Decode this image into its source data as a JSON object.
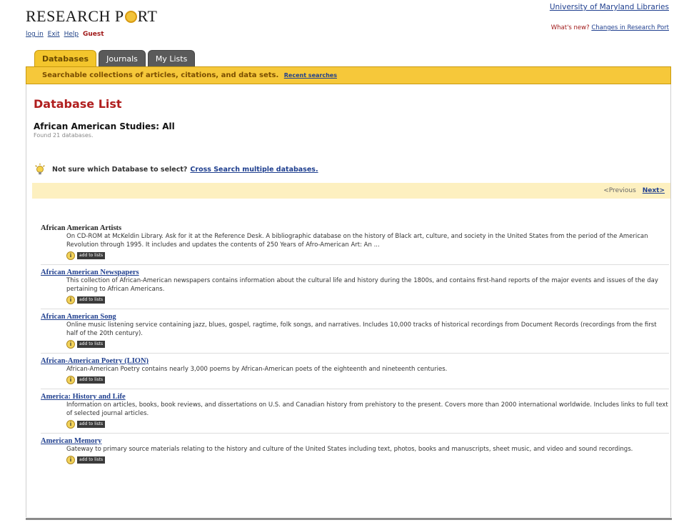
{
  "header": {
    "logo_part1": "RESEARCH P",
    "logo_part2": "RT",
    "login": "log in",
    "exit": "Exit",
    "help": "Help",
    "user": "Guest",
    "umd_link": "University of Maryland Libraries",
    "whats_new": "What's new?",
    "changes_link": "Changes in Research Port"
  },
  "tabs": [
    {
      "label": "Databases",
      "active": true
    },
    {
      "label": "Journals",
      "active": false
    },
    {
      "label": "My Lists",
      "active": false
    }
  ],
  "banner": {
    "text": "Searchable collections of articles, citations, and data sets.",
    "link": "Recent searches"
  },
  "main": {
    "title": "Database List",
    "subtitle": "African American Studies: All",
    "found": "Found 21 databases.",
    "hint": "Not sure which Database to select?",
    "hint_link": "Cross Search multiple databases.",
    "prev": "<Previous",
    "next": "Next>"
  },
  "entries": [
    {
      "title": "African American Artists",
      "desc": "On CD-ROM at McKeldin Library. Ask for it at the Reference Desk. A bibliographic database on the history of Black art, culture, and society in the United States from the period of the American Revolution through 1995. It includes and updates the contents of 250 Years of Afro-American Art: An ..."
    },
    {
      "title": "African American Newspapers",
      "desc": "This collection of African-American newspapers contains information about the cultural life and history during the 1800s, and contains first-hand reports of the major events and issues of the day pertaining to African Americans."
    },
    {
      "title": "African American Song",
      "desc": "Online music listening service containing jazz, blues, gospel, ragtime, folk songs, and narratives. Includes 10,000 tracks of historical recordings from Document Records (recordings from the first half of the 20th century)."
    },
    {
      "title": "African-American Poetry (LION)",
      "desc": "African-American Poetry contains nearly 3,000 poems by African-American poets of the eighteenth and nineteenth centuries."
    },
    {
      "title": "America: History and Life",
      "desc": "Information on articles, books, book reviews, and dissertations on U.S. and Canadian history from prehistory to the present. Covers more than 2000 international worldwide. Includes links to full text of selected journal articles."
    },
    {
      "title": "American Memory",
      "desc": "Gateway to primary source materials relating to the history and culture of the United States including text, photos, books and manuscripts, sheet music, and video and sound recordings."
    }
  ],
  "entry_controls": {
    "info": "i",
    "add": "add to lists"
  }
}
